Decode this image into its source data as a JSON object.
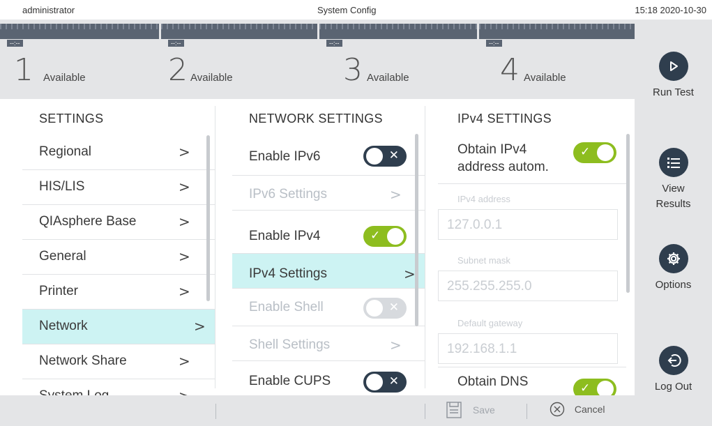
{
  "topbar": {
    "user": "administrator",
    "title": "System Config",
    "time": "15:18 2020-10-30"
  },
  "modules": [
    {
      "code": "--:--",
      "number": "1",
      "status": "Available"
    },
    {
      "code": "--:--",
      "number": "2",
      "status": "Available"
    },
    {
      "code": "--:--",
      "number": "3",
      "status": "Available"
    },
    {
      "code": "--:--",
      "number": "4",
      "status": "Available"
    }
  ],
  "sidenav": {
    "run_test": "Run Test",
    "view_results": "View Results",
    "options": "Options",
    "log_out": "Log Out"
  },
  "settings": {
    "heading": "SETTINGS",
    "items": [
      "Regional",
      "HIS/LIS",
      "QIAsphere Base",
      "General",
      "Printer",
      "Network",
      "Network Share",
      "System Log"
    ],
    "active": "Network"
  },
  "network": {
    "heading": "NETWORK SETTINGS",
    "rows": [
      {
        "label": "Enable IPv6",
        "kind": "toggle",
        "state": "off"
      },
      {
        "label": "IPv6 Settings",
        "kind": "link",
        "state": "disabled"
      },
      {
        "label": "Enable IPv4",
        "kind": "toggle",
        "state": "on"
      },
      {
        "label": "IPv4 Settings",
        "kind": "link",
        "state": "active"
      },
      {
        "label": "Enable Shell",
        "kind": "toggle",
        "state": "disabled"
      },
      {
        "label": "Shell Settings",
        "kind": "link",
        "state": "disabled"
      },
      {
        "label": "Enable CUPS",
        "kind": "toggle",
        "state": "off"
      }
    ]
  },
  "ipv4": {
    "heading": "IPv4 SETTINGS",
    "obtain_auto_label": "Obtain IPv4 address autom.",
    "obtain_auto_line1": "Obtain IPv4",
    "obtain_auto_line2": "address autom.",
    "address_label": "IPv4 address",
    "address_value": "127.0.0.1",
    "subnet_label": "Subnet mask",
    "subnet_value": "255.255.255.0",
    "gateway_label": "Default gateway",
    "gateway_value": "192.168.1.1",
    "obtain_dns_label": "Obtain DNS"
  },
  "bottombar": {
    "save": "Save",
    "cancel": "Cancel"
  },
  "colors": {
    "accent_green": "#8dbd1f",
    "dark_navy": "#2f3e4e",
    "active_cyan": "#cdf3f3",
    "bar_grey": "#e4e5e7"
  }
}
